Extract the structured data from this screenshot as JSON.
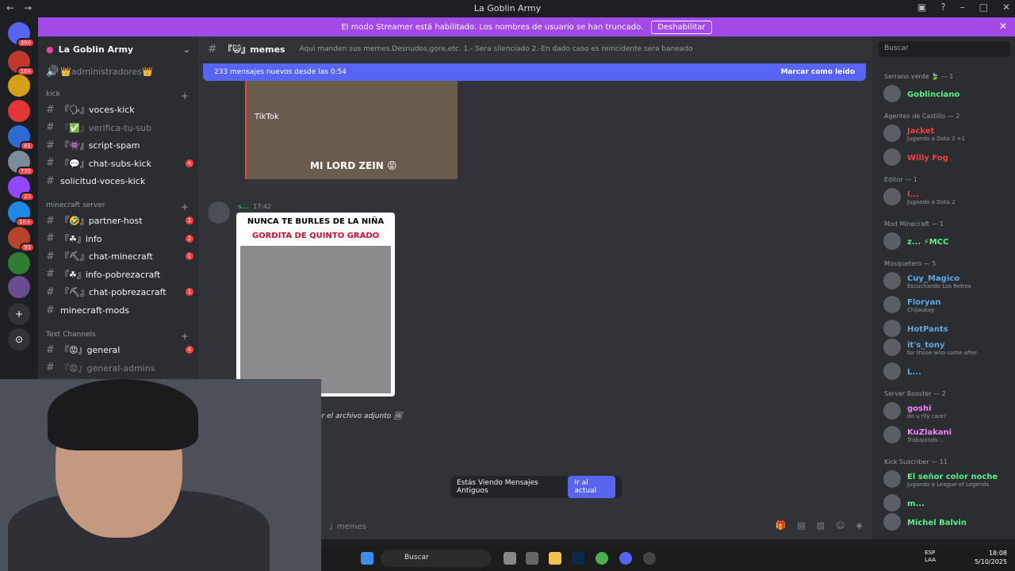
{
  "window": {
    "title": "La Goblin Army"
  },
  "banner": {
    "text": "El modo Streamer está habilitado. Los nombres de usuario se han truncado.",
    "button": "Deshabilitar"
  },
  "servers": [
    {
      "badge": "390"
    },
    {
      "badge": "164"
    },
    {
      "badge": ""
    },
    {
      "badge": ""
    },
    {
      "badge": "81"
    },
    {
      "badge": "735"
    },
    {
      "badge": "20"
    },
    {
      "badge": "1K+"
    },
    {
      "badge": "93"
    },
    {
      "badge": ""
    },
    {
      "badge": ""
    }
  ],
  "guild": {
    "name": "La Goblin Army"
  },
  "channels": {
    "top": "👑administradores👑",
    "cat_kick": "kick",
    "kick": [
      {
        "name": "『🗣』voces-kick",
        "count": ""
      },
      {
        "name": "『✅』verifica-tu-sub",
        "count": "",
        "muted": true
      },
      {
        "name": "『👾』script-spam",
        "count": ""
      },
      {
        "name": "『💬』chat-subs-kick",
        "count": "4"
      },
      {
        "name": "solicitud-voces-kick",
        "count": ""
      }
    ],
    "cat_mc": "minecraft server",
    "mc": [
      {
        "name": "『🤣』partner-host",
        "count": "1"
      },
      {
        "name": "『☘』info",
        "count": "2"
      },
      {
        "name": "『⛏』chat-minecraft",
        "count": "1"
      },
      {
        "name": "『☘』info-pobrezacraft",
        "count": ""
      },
      {
        "name": "『⛏』chat-pobrezacraft",
        "count": "1"
      },
      {
        "name": "minecraft-mods",
        "count": ""
      }
    ],
    "cat_text": "Text Channels",
    "text": [
      {
        "name": "『😡』general",
        "count": "4"
      },
      {
        "name": "『😡』general-admins",
        "count": "",
        "muted": true
      }
    ]
  },
  "chat": {
    "channel": "『😺』memes",
    "topic": "Aqui manden sus memes.Desnudos,gore,etc. 1.- Sera silenciado 2.-En dado caso es reincidente sera baneado",
    "newbar": "233 mensajes nuevos desde las 0:54",
    "mark_read": "Marcar como leído",
    "img1_tiktok": "TikTok",
    "img1_caption": "MI LORD ZEIN 😝",
    "author": "s...",
    "time": "17:42",
    "meme_line1": "NUNCA TE BURLES DE LA NIÑA",
    "meme_line2": "GORDITA DE QUINTO GRADO",
    "attach_text": "er el archivo adjunto",
    "old_text": "Estás Viendo Mensajes Antiguos",
    "old_button": "Ir al actual",
    "composer": "』memes"
  },
  "members": {
    "search": "Buscar",
    "groups": [
      {
        "title": "Serrano verde 🍃 — 1",
        "items": [
          {
            "name": "Goblinciano",
            "color": "#57f287",
            "status": ""
          }
        ]
      },
      {
        "title": "Agentes de Castillo — 2",
        "items": [
          {
            "name": "Jacket",
            "color": "#ed4245",
            "status": "Jugando a Dota 2 +1"
          },
          {
            "name": "Willy Fog",
            "color": "#ed4245",
            "status": ""
          }
        ]
      },
      {
        "title": "Editor — 1",
        "items": [
          {
            "name": "I...",
            "color": "#ed4245",
            "status": "Jugando a Dota 2"
          }
        ]
      },
      {
        "title": "Mod Minecraft — 1",
        "items": [
          {
            "name": "z... ⚡MCC",
            "color": "#57f287",
            "status": ""
          }
        ]
      },
      {
        "title": "Mosquetero — 5",
        "items": [
          {
            "name": "Cuy_Magico",
            "color": "#5da9e9",
            "status": "Escuchando Los Retros"
          },
          {
            "name": "Floryan",
            "color": "#5da9e9",
            "status": "Chijaukay"
          },
          {
            "name": "HotPants",
            "color": "#5da9e9",
            "status": ""
          },
          {
            "name": "it's_tony",
            "color": "#5da9e9",
            "status": "for those who come after"
          },
          {
            "name": "L...",
            "color": "#5da9e9",
            "status": ""
          }
        ]
      },
      {
        "title": "Server Booster — 2",
        "items": [
          {
            "name": "goshi",
            "color": "#f47fff",
            "status": "do u rlly care?"
          },
          {
            "name": "KuZlakani",
            "color": "#f47fff",
            "status": "Trabajando ..."
          }
        ]
      },
      {
        "title": "Kick Suscriber — 11",
        "items": [
          {
            "name": "El señor color noche",
            "color": "#57f287",
            "status": "Jugando a League of Legends"
          },
          {
            "name": "m...",
            "color": "#57f287",
            "status": ""
          },
          {
            "name": "Michel Balvin",
            "color": "#57f287",
            "status": ""
          }
        ]
      }
    ]
  },
  "taskbar": {
    "search": "Buscar",
    "lang1": "ESP",
    "lang2": "LAA",
    "time": "18:08",
    "date": "5/10/2025"
  }
}
